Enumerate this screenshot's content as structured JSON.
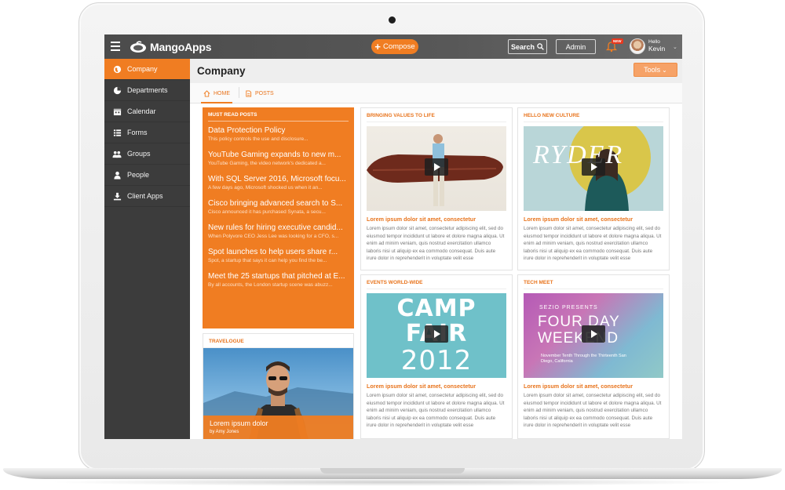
{
  "app": {
    "name": "MangoApps"
  },
  "topbar": {
    "compose_label": "Compose",
    "search_label": "Search",
    "admin_label": "Admin",
    "new_badge": "NEW",
    "greeting": "Hello",
    "user_name": "Kevin"
  },
  "sidebar": {
    "items": [
      {
        "label": "Company",
        "icon": "globe-icon",
        "active": true
      },
      {
        "label": "Departments",
        "icon": "pie-chart-icon",
        "active": false
      },
      {
        "label": "Calendar",
        "icon": "calendar-icon",
        "active": false
      },
      {
        "label": "Forms",
        "icon": "list-icon",
        "active": false
      },
      {
        "label": "Groups",
        "icon": "group-icon",
        "active": false
      },
      {
        "label": "People",
        "icon": "person-icon",
        "active": false
      },
      {
        "label": "Client Apps",
        "icon": "download-icon",
        "active": false
      }
    ]
  },
  "page": {
    "title": "Company",
    "tools_label": "Tools",
    "tabs": [
      {
        "label": "HOME"
      },
      {
        "label": "POSTS"
      }
    ]
  },
  "must_read": {
    "heading": "MUST READ POSTS",
    "posts": [
      {
        "title": "Data Protection Policy",
        "snippet": "This policy controls the use and disclosure..."
      },
      {
        "title": "YouTube Gaming expands to new m...",
        "snippet": "YouTube Gaming, the video network's dedicated a..."
      },
      {
        "title": "With SQL Server 2016, Microsoft focu...",
        "snippet": "A few days ago, Microsoft shocked us when it an..."
      },
      {
        "title": "Cisco bringing advanced search to S...",
        "snippet": "Cisco announced it has purchased Synata, a secu..."
      },
      {
        "title": "New rules for hiring executive candid...",
        "snippet": "When Polyvore CEO Jess Lee was looking for a CFO, s..."
      },
      {
        "title": "Spot launches to help users share r...",
        "snippet": "Spot, a startup that says it can help you find the be..."
      },
      {
        "title": "Meet the 25 startups that pitched at E...",
        "snippet": "By all accounts, the London startup scene was abuzz..."
      }
    ]
  },
  "travelogue": {
    "heading": "TRAVELOGUE",
    "caption_title": "Lorem ipsum dolor",
    "byline": "by Amy Jones"
  },
  "cards": [
    {
      "heading": "BRINGING VALUES TO LIFE",
      "title": "Lorem ipsum dolor sit amet, consectetur",
      "body": "Lorem ipsum dolor sit amet, consectetur adipiscing elit, sed do eiusmod tempor incididunt ut labore et dolore magna aliqua. Ut enim ad minim veniam, quis nostrud exercitation ullamco laboris nisi ut aliquip ex ea commodo consequat. Duis aute irure dolor in reprehenderit in voluptate velit esse"
    },
    {
      "heading": "HELLO NEW CULTURE",
      "title": "Lorem ipsum dolor sit amet, consectetur",
      "body": "Lorem ipsum dolor sit amet, consectetur adipiscing elit, sed do eiusmod tempor incididunt ut labore et dolore magna aliqua. Ut enim ad minim veniam, quis nostrud exercitation ullamco laboris nisi ut aliquip ex ea commodo consequat. Duis aute irure dolor in reprehenderit in voluptate velit esse",
      "media_text": "RYDER"
    },
    {
      "heading": "EVENTS WORLD-WIDE",
      "title": "Lorem ipsum dolor sit amet, consectetur",
      "body": "Lorem ipsum dolor sit amet, consectetur adipiscing elit, sed do eiusmod tempor incididunt ut labore et dolore magna aliqua. Ut enim ad minim veniam, quis nostrud exercitation ullamco laboris nisi ut aliquip ex ea commodo consequat. Duis aute irure dolor in reprehenderit in voluptate velit esse",
      "media_lines": [
        "CAMP",
        "FAIR",
        "2012"
      ]
    },
    {
      "heading": "TECH MEET",
      "title": "Lorem ipsum dolor sit amet, consectetur",
      "body": "Lorem ipsum dolor sit amet, consectetur adipiscing elit, sed do eiusmod tempor incididunt ut labore et dolore magna aliqua. Ut enim ad minim veniam, quis nostrud exercitation ullamco laboris nisi ut aliquip ex ea commodo consequat. Duis aute irure dolor in reprehenderit in voluptate velit esse",
      "media_small": "SEZIO PRESENTS",
      "media_big_1": "FOUR DAY",
      "media_big_2": "WEEKEND",
      "media_date": "November Tenth Through the Thirteenth San Diego, California"
    }
  ],
  "colors": {
    "accent": "#f07d22",
    "sidebar": "#3c3c3c",
    "topbar": "#545454"
  }
}
